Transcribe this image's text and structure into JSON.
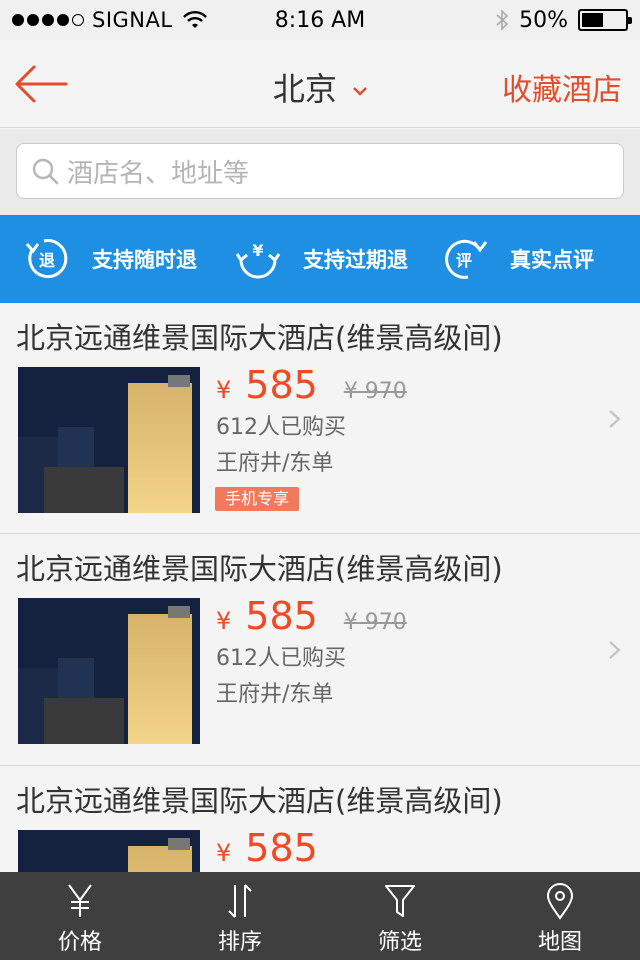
{
  "status": {
    "carrier": "SIGNAL",
    "time": "8:16 AM",
    "battery": "50%",
    "battery_level": 0.5
  },
  "nav": {
    "city": "北京",
    "favorite_label": "收藏酒店"
  },
  "search": {
    "placeholder": "酒店名、地址等"
  },
  "promise": {
    "items": [
      {
        "icon_text": "退",
        "label": "支持随时退"
      },
      {
        "icon_text": "¥",
        "label": "支持过期退"
      },
      {
        "icon_text": "评",
        "label": "真实点评"
      }
    ]
  },
  "hotels": [
    {
      "name": "北京远通维景国际大酒店(维景高级间)",
      "currency": "¥",
      "price": "585",
      "original_price": "¥ 970",
      "sold": "612人已购买",
      "area": "王府井/东单",
      "tag": "手机专享"
    },
    {
      "name": "北京远通维景国际大酒店(维景高级间)",
      "currency": "¥",
      "price": "585",
      "original_price": "¥ 970",
      "sold": "612人已购买",
      "area": "王府井/东单",
      "tag": ""
    },
    {
      "name": "北京远通维景国际大酒店(维景高级间)",
      "currency": "¥",
      "price": "585",
      "original_price": "",
      "sold": "",
      "area": "",
      "tag": ""
    }
  ],
  "tabbar": {
    "items": [
      {
        "label": "价格",
        "icon": "yen-icon"
      },
      {
        "label": "排序",
        "icon": "sort-icon"
      },
      {
        "label": "筛选",
        "icon": "filter-icon"
      },
      {
        "label": "地图",
        "icon": "map-pin-icon"
      }
    ]
  },
  "colors": {
    "accent": "#e24e2c",
    "price": "#f04a24",
    "banner": "#1e8fe3",
    "tabbar": "#3f3f3f",
    "tag": "#f07a5a"
  }
}
